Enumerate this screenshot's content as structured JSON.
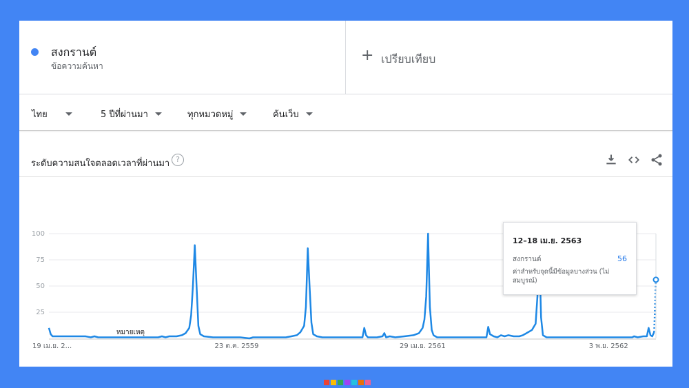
{
  "term": {
    "name": "สงกรานต์",
    "type": "ข้อความค้นหา",
    "color": "#4285f4"
  },
  "compare": {
    "label": "เปรียบเทียบ"
  },
  "filters": {
    "region": "ไทย",
    "time": "5 ปีที่ผ่านมา",
    "category": "ทุกหมวดหมู่",
    "search_type": "ค้นเว็บ"
  },
  "panel": {
    "title": "ระดับความสนใจตลอดเวลาที่ผ่านมา",
    "icons": [
      "help-icon",
      "download-icon",
      "embed-icon",
      "share-icon"
    ]
  },
  "chart_data": {
    "type": "line",
    "title": "ระดับความสนใจตลอดเวลาที่ผ่านมา",
    "ylim": [
      0,
      100
    ],
    "y_ticks": [
      "100",
      "75",
      "50",
      "25"
    ],
    "x_tick_labels": [
      "19 เม.ย. 2...",
      "23 ต.ค. 2559",
      "29 เม.ย. 2561",
      "3 พ.ย. 2562"
    ],
    "note_label": "หมายเหตุ",
    "grid": true,
    "line_color": "#1e88e5",
    "series": [
      {
        "name": "สงกรานต์",
        "points": [
          [
            0,
            10
          ],
          [
            1,
            4
          ],
          [
            2,
            2
          ],
          [
            10,
            2
          ],
          [
            20,
            2
          ],
          [
            23,
            1
          ],
          [
            25,
            2
          ],
          [
            27,
            1
          ],
          [
            30,
            1
          ],
          [
            35,
            1
          ],
          [
            40,
            1
          ],
          [
            45,
            1
          ],
          [
            55,
            1
          ],
          [
            60,
            1
          ],
          [
            62,
            2
          ],
          [
            64,
            1
          ],
          [
            66,
            2
          ],
          [
            70,
            2
          ],
          [
            73,
            3
          ],
          [
            75,
            5
          ],
          [
            77,
            10
          ],
          [
            78,
            22
          ],
          [
            79,
            50
          ],
          [
            80,
            89
          ],
          [
            81,
            50
          ],
          [
            82,
            12
          ],
          [
            83,
            4
          ],
          [
            85,
            2
          ],
          [
            90,
            1
          ],
          [
            100,
            1
          ],
          [
            105,
            1
          ],
          [
            110,
            0
          ],
          [
            112,
            1
          ],
          [
            115,
            1
          ],
          [
            120,
            1
          ],
          [
            125,
            1
          ],
          [
            130,
            1
          ],
          [
            133,
            2
          ],
          [
            136,
            3
          ],
          [
            138,
            6
          ],
          [
            140,
            12
          ],
          [
            141,
            30
          ],
          [
            142,
            86
          ],
          [
            143,
            50
          ],
          [
            144,
            15
          ],
          [
            145,
            4
          ],
          [
            147,
            2
          ],
          [
            150,
            1
          ],
          [
            155,
            1
          ],
          [
            165,
            1
          ],
          [
            170,
            1
          ],
          [
            172,
            1
          ],
          [
            173,
            10
          ],
          [
            174,
            3
          ],
          [
            175,
            1
          ],
          [
            180,
            1
          ],
          [
            183,
            2
          ],
          [
            184,
            5
          ],
          [
            185,
            1
          ],
          [
            187,
            2
          ],
          [
            190,
            1
          ],
          [
            195,
            2
          ],
          [
            200,
            3
          ],
          [
            203,
            5
          ],
          [
            205,
            10
          ],
          [
            206,
            18
          ],
          [
            207,
            40
          ],
          [
            208,
            100
          ],
          [
            209,
            30
          ],
          [
            210,
            8
          ],
          [
            211,
            3
          ],
          [
            213,
            1
          ],
          [
            220,
            1
          ],
          [
            230,
            1
          ],
          [
            240,
            1
          ],
          [
            241,
            11
          ],
          [
            242,
            4
          ],
          [
            244,
            2
          ],
          [
            246,
            1
          ],
          [
            248,
            3
          ],
          [
            250,
            2
          ],
          [
            252,
            3
          ],
          [
            255,
            2
          ],
          [
            258,
            2
          ],
          [
            260,
            3
          ],
          [
            262,
            5
          ],
          [
            265,
            8
          ],
          [
            267,
            14
          ],
          [
            268,
            40
          ],
          [
            269,
            85
          ],
          [
            270,
            20
          ],
          [
            271,
            3
          ],
          [
            273,
            1
          ],
          [
            280,
            1
          ],
          [
            290,
            1
          ],
          [
            300,
            1
          ],
          [
            310,
            1
          ],
          [
            320,
            1
          ],
          [
            321,
            2
          ],
          [
            323,
            1
          ],
          [
            326,
            2
          ],
          [
            328,
            2
          ],
          [
            329,
            10
          ],
          [
            330,
            3
          ],
          [
            331,
            2
          ],
          [
            332,
            6
          ]
        ],
        "partial_points": [
          [
            332,
            6
          ],
          [
            333,
            56
          ]
        ]
      }
    ]
  },
  "tooltip": {
    "date": "12–18 เม.ย. 2563",
    "term": "สงกรานต์",
    "value": "56",
    "note": "ค่าสำหรับจุดนี้มีข้อมูลบางส่วน (ไม่สมบูรณ์)"
  },
  "footer_colors": [
    "#4285f4",
    "#ea4335",
    "#fbbc04",
    "#34a853",
    "#a142f4",
    "#24c1e0",
    "#e8710a",
    "#f06292"
  ]
}
